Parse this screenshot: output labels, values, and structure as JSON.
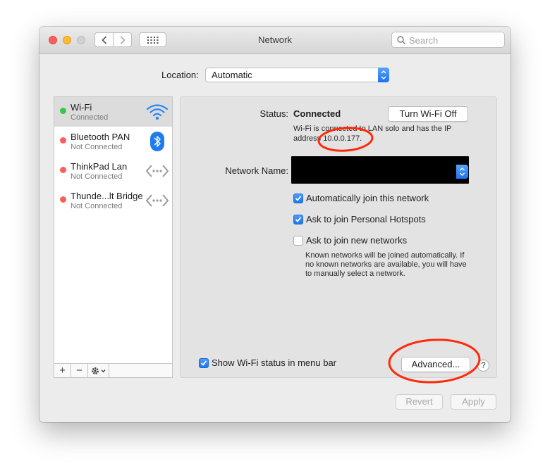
{
  "window": {
    "title": "Network",
    "search_placeholder": "Search"
  },
  "location": {
    "label": "Location:",
    "value": "Automatic"
  },
  "services": [
    {
      "name": "Wi-Fi",
      "status": "Connected",
      "dot_color": "#34c84a",
      "icon": "wifi-icon",
      "selected": true
    },
    {
      "name": "Bluetooth PAN",
      "status": "Not Connected",
      "dot_color": "#fc5f57",
      "icon": "bluetooth-icon"
    },
    {
      "name": "ThinkPad Lan",
      "status": "Not Connected",
      "dot_color": "#fc5f57",
      "icon": "ethernet-icon"
    },
    {
      "name": "Thunde...lt Bridge",
      "status": "Not Connected",
      "dot_color": "#fc5f57",
      "icon": "ethernet-icon"
    }
  ],
  "sidebar_toolbar": {
    "add": "+",
    "remove": "−"
  },
  "detail": {
    "status_label": "Status:",
    "status_value": "Connected",
    "turn_off_button": "Turn Wi-Fi Off",
    "status_line1": "Wi-Fi is connected to LAN solo and has the IP",
    "status_line2": "address 10.0.0.177.",
    "network_name_label": "Network Name:",
    "checkboxes": [
      {
        "label": "Automatically join this network",
        "checked": true
      },
      {
        "label": "Ask to join Personal Hotspots",
        "checked": true
      },
      {
        "label": "Ask to join new networks",
        "checked": false
      }
    ],
    "hint_line1": "Known networks will be joined automatically. If",
    "hint_line2": "no known networks are available, you will have",
    "hint_line3": "to manually select a network.",
    "show_status_label": "Show Wi-Fi status in menu bar",
    "show_status_checked": true,
    "advanced_button": "Advanced...",
    "help": "?"
  },
  "footer": {
    "revert": "Revert",
    "apply": "Apply"
  },
  "colors": {
    "accent": "#1b74f0",
    "annotation": "#ff2a0a"
  }
}
